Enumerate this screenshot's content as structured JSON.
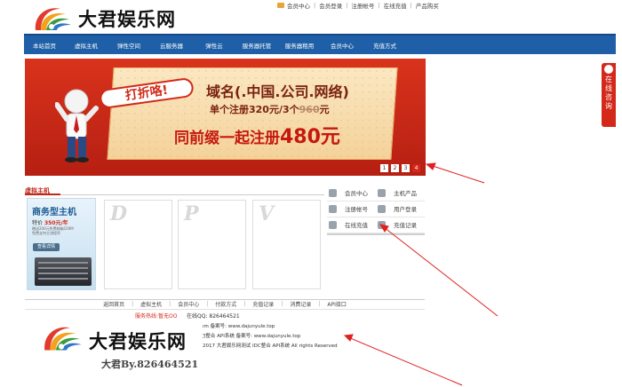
{
  "site": {
    "brand": "大君娱乐网",
    "colors": {
      "nav": "#1f5fa7",
      "accent": "#d3281a"
    }
  },
  "toplinks": [
    "会员中心",
    "会员登录",
    "注册帐号",
    "在线充值",
    "产品购买"
  ],
  "nav": [
    "本站首页",
    "虚拟主机",
    "弹性空间",
    "云服务器",
    "弹性云",
    "服务器托管",
    "服务器租用",
    "会员中心",
    "充值方式"
  ],
  "banner": {
    "tag": "打折咯!",
    "line1": "域名(.中国.公司.网络)",
    "line2_a": "单个注册320元/3个",
    "line2_strike": "960",
    "line2_b": "元",
    "line3_a": "同前缀一起注册",
    "line3_big": "480元",
    "pages": [
      "1",
      "2",
      "3",
      "4"
    ],
    "active_page": "4"
  },
  "float_tab": [
    "在",
    "线",
    "咨",
    "询"
  ],
  "host_section": {
    "title": "虚拟主机",
    "promo": {
      "title": "商务型主机",
      "price_label": "特价",
      "price": "350元/年",
      "desc1": "赠送200元免费邮箱100M",
      "desc2": "免费支持主流程序",
      "button": "查看详情"
    },
    "cards": [
      "D",
      "P",
      "V"
    ]
  },
  "panel": [
    {
      "label": "会员中心",
      "icon": "user-icon"
    },
    {
      "label": "主机产品",
      "icon": "server-icon"
    },
    {
      "label": "注册帐号",
      "icon": "register-icon"
    },
    {
      "label": "用户登录",
      "icon": "login-icon"
    },
    {
      "label": "在线充值",
      "icon": "recharge-icon"
    },
    {
      "label": "充值记录",
      "icon": "record-icon"
    }
  ],
  "footer": {
    "links": [
      "返回首页",
      "虚拟主机",
      "会员中心",
      "付款方式",
      "充值记录",
      "消费记录",
      "API接口"
    ],
    "hotline": "服务热线:暂无OO",
    "qq": "在线QQ: 826464521",
    "info1": "ım  备案号: www.dajunyule.top",
    "info2": "ℨ整合 API系统  备案号: www.dajunyule.top",
    "info3": "2017 大君娱乐网测试 IDC整合 API系统 All rights Reserved",
    "brand": "大君娱乐网",
    "signature": "大君By.826464521"
  }
}
